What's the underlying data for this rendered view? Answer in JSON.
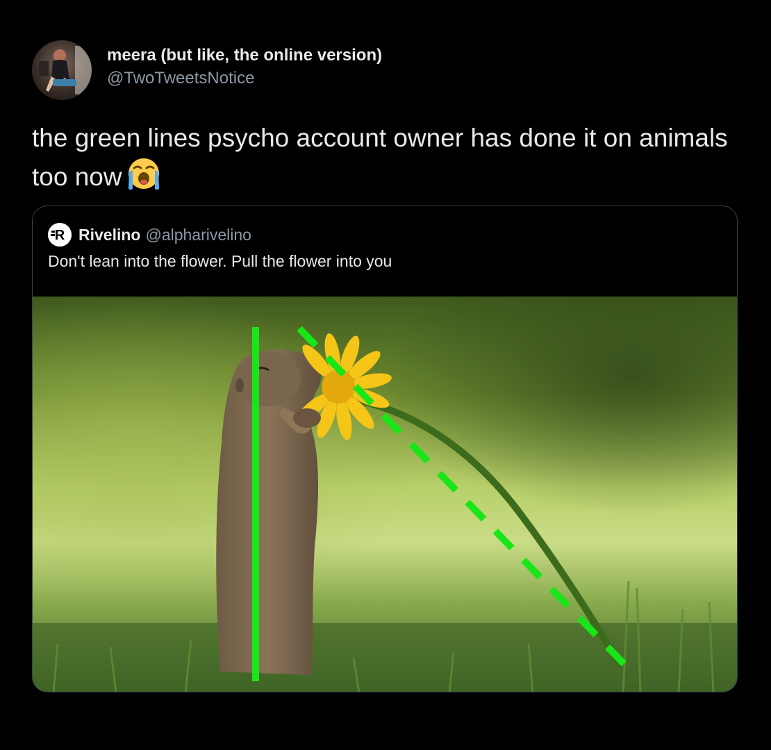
{
  "tweet": {
    "display_name": "meera (but like, the online version)",
    "handle": "@TwoTweetsNotice",
    "text": "the green lines psycho account owner has done it on animals too now",
    "emoji": "loudly-crying-face-emoji"
  },
  "quoted_tweet": {
    "logo_letter": "R",
    "display_name": "Rivelino",
    "handle": "@alpharivelino",
    "text": "Don't lean into the flower. Pull the flower into you",
    "image": {
      "subject": "squirrel-smelling-yellow-flower",
      "solid_line_color": "#19e619",
      "dashed_line_color": "#19e619",
      "flower_color": "#f5c518",
      "stem_color": "#3d6b1c"
    }
  },
  "colors": {
    "background": "#000000",
    "text_primary": "#e7e9ea",
    "text_secondary": "#8b98a5",
    "border": "#38444d"
  }
}
